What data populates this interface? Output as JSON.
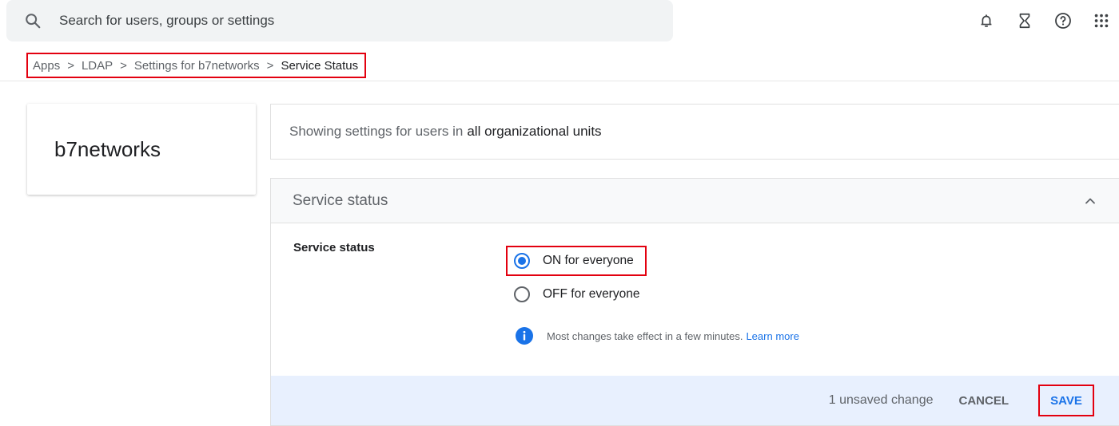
{
  "search": {
    "placeholder": "Search for users, groups or settings",
    "icon": "search-icon"
  },
  "top_icons": [
    "bell-icon",
    "hourglass-icon",
    "help-icon",
    "apps-grid-icon"
  ],
  "breadcrumb": {
    "items": [
      "Apps",
      "LDAP",
      "Settings for b7networks"
    ],
    "current": "Service Status",
    "separator": ">"
  },
  "org": {
    "name": "b7networks"
  },
  "scope": {
    "label": "Showing settings for users in",
    "value": "all organizational units"
  },
  "panel": {
    "title": "Service status",
    "row_label": "Service status",
    "options": [
      {
        "label": "ON for everyone",
        "selected": true
      },
      {
        "label": "OFF for everyone",
        "selected": false
      }
    ],
    "info_text": "Most changes take effect in a few minutes.",
    "info_link": "Learn more"
  },
  "footer": {
    "unsaved": "1 unsaved change",
    "cancel_label": "CANCEL",
    "save_label": "SAVE"
  },
  "colors": {
    "accent": "#1a73e8",
    "highlight_border": "#e3000f",
    "footer_bg": "#e8f0fe"
  }
}
